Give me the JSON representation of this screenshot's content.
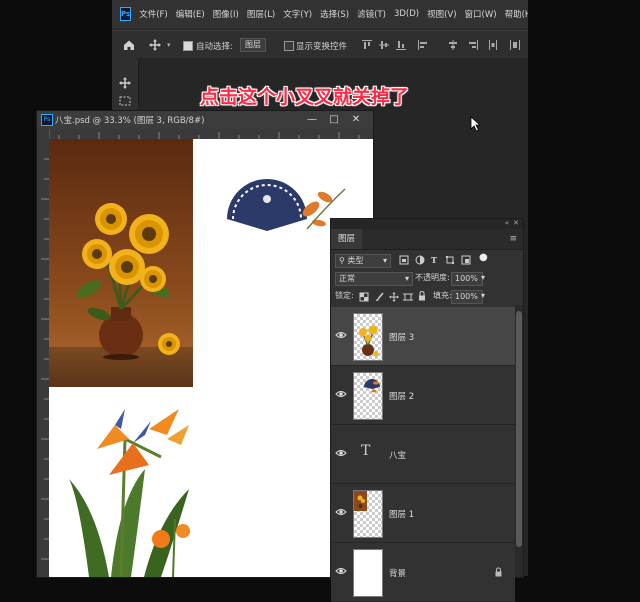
{
  "menubar": {
    "logo": "Ps",
    "items": [
      "文件(F)",
      "编辑(E)",
      "图像(I)",
      "图层(L)",
      "文字(Y)",
      "选择(S)",
      "滤镜(T)",
      "3D(D)",
      "视图(V)",
      "窗口(W)",
      "帮助(H)"
    ]
  },
  "options": {
    "auto_select_label": "自动选择:",
    "auto_select_value": "图层",
    "show_transform_label": "显示变换控件"
  },
  "caption": "点击这个小叉叉就关掉了",
  "document": {
    "icon": "Ps",
    "title": "八宝.psd @ 33.3% (图层 3, RGB/8#)",
    "minimize": "—",
    "maximize": "□",
    "close": "✕"
  },
  "layers_panel": {
    "tab": "图层",
    "menu": "≡",
    "filter_label": "类型",
    "blend_mode": "正常",
    "opacity_label": "不透明度:",
    "opacity_value": "100%",
    "lock_label": "锁定:",
    "fill_label": "填充:",
    "fill_value": "100%",
    "layers": [
      {
        "name": "图层 3",
        "kind": "image",
        "selected": true
      },
      {
        "name": "图层 2",
        "kind": "image",
        "selected": false
      },
      {
        "name": "八宝",
        "kind": "text",
        "selected": false
      },
      {
        "name": "图层 1",
        "kind": "image",
        "selected": false
      },
      {
        "name": "背景",
        "kind": "background",
        "selected": false,
        "locked": true
      }
    ]
  },
  "colors": {
    "caption": "#ff2a45",
    "accent": "#31a8ff"
  }
}
